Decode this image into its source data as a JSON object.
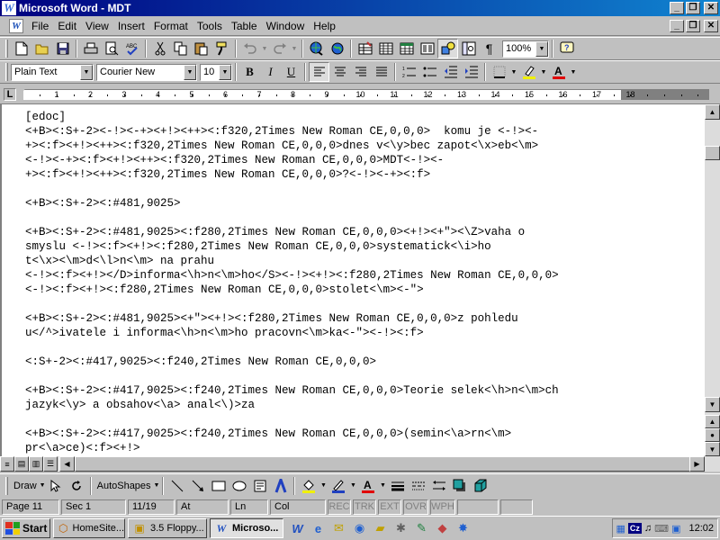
{
  "window": {
    "title": "Microsoft Word - MDT",
    "app_icon_letter": "W",
    "min_glyph": "_",
    "max_glyph": "❐",
    "close_glyph": "✕"
  },
  "menu": {
    "items": [
      "File",
      "Edit",
      "View",
      "Insert",
      "Format",
      "Tools",
      "Table",
      "Window",
      "Help"
    ]
  },
  "standard_toolbar": {
    "zoom": "100%"
  },
  "format_toolbar": {
    "style": "Plain Text",
    "font": "Courier New",
    "size": "10",
    "bold": "B",
    "italic": "I",
    "underline": "U"
  },
  "ruler": {
    "tab_selector": "L",
    "numbers": [
      "1",
      "2",
      "3",
      "4",
      "5",
      "6",
      "7",
      "8",
      "9",
      "10",
      "11",
      "12",
      "13",
      "14",
      "15",
      "16",
      "17",
      "18"
    ]
  },
  "document": {
    "lines": [
      "[edoc]",
      "<+B><:S+-2><-!><-+><+!><++><:f320,2Times New Roman CE,0,0,0>  komu je <-!><-",
      "+><:f><+!><++><:f320,2Times New Roman CE,0,0,0>dnes v<\\y>bec zapot<\\x>eb<\\m>",
      "<-!><-+><:f><+!><++><:f320,2Times New Roman CE,0,0,0>MDT<-!><-",
      "+><:f><+!><++><:f320,2Times New Roman CE,0,0,0>?<-!><-+><:f>",
      "",
      "<+B><:S+-2><:#481,9025>",
      "",
      "<+B><:S+-2><:#481,9025><:f280,2Times New Roman CE,0,0,0><+!><+\"><\\Z>vaha o",
      "smyslu <-!><:f><+!><:f280,2Times New Roman CE,0,0,0>systematick<\\i>ho",
      "t<\\x><\\m>d<\\l>n<\\m> na prahu",
      "<-!><:f><+!></D>informa<\\h>n<\\m>ho</S><-!><+!><:f280,2Times New Roman CE,0,0,0>",
      "<-!><:f><+!><:f280,2Times New Roman CE,0,0,0>stolet<\\m><-\">",
      "",
      "<+B><:S+-2><:#481,9025><+\"><+!><:f280,2Times New Roman CE,0,0,0>z pohledu",
      "u</^>ivatele i informa<\\h>n<\\m>ho pracovn<\\m>ka<-\"><-!><:f>",
      "",
      "<:S+-2><:#417,9025><:f240,2Times New Roman CE,0,0,0>",
      "",
      "<+B><:S+-2><:#417,9025><:f240,2Times New Roman CE,0,0,0>Teorie selek<\\h>n<\\m>ch",
      "jazyk<\\y> a obsahov<\\a> anal<\\)>za",
      "",
      "<+B><:S+-2><:#417,9025><:f240,2Times New Roman CE,0,0,0>(semin<\\a>rn<\\m>",
      "pr<\\a>ce)<:f><+!>"
    ]
  },
  "drawing_toolbar": {
    "draw": "Draw",
    "autoshapes": "AutoShapes"
  },
  "status": {
    "page": "Page 11",
    "sec": "Sec 1",
    "page_of": "11/19",
    "at": "At",
    "ln": "Ln",
    "col": "Col",
    "rec": "REC",
    "trk": "TRK",
    "ext": "EXT",
    "ovr": "OVR",
    "wph": "WPH"
  },
  "taskbar": {
    "start": "Start",
    "tasks": [
      {
        "label": "HomeSite...",
        "icon": "homesite-icon",
        "active": false
      },
      {
        "label": "3.5 Floppy...",
        "icon": "floppy-icon",
        "active": false
      },
      {
        "label": "Microso...",
        "icon": "word-icon",
        "active": true
      }
    ],
    "language": "Cz",
    "clock": "12:02"
  }
}
